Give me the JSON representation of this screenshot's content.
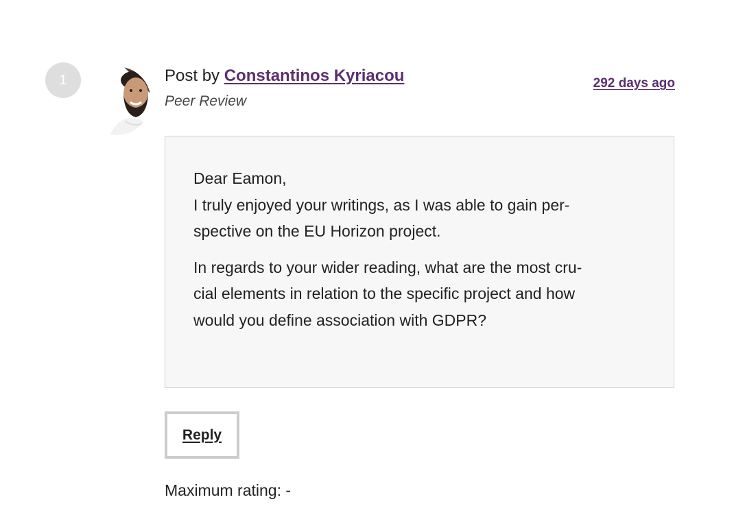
{
  "post": {
    "number": "1",
    "prefix": "Post by",
    "author": "Constantinos Kyriacou",
    "type": "Peer Review",
    "time_ago": "292 days ago",
    "message": {
      "greeting": "Dear Eamon,",
      "line1": "I truly enjoyed your writings, as I was able to gain per-spective on the EU Horizon project.",
      "paragraph2": "In regards to your wider reading, what are the most cru-cial elements in relation to the specific project and how would you define association with GDPR?"
    },
    "reply_label": "Reply",
    "rating_text": "Maximum rating: -"
  },
  "colors": {
    "link": "#5b2f6e",
    "box_background": "#f7f7f7",
    "box_border": "#d0d0d0",
    "badge_background": "#dedede"
  },
  "icons": {
    "avatar": "user-avatar-photo"
  }
}
